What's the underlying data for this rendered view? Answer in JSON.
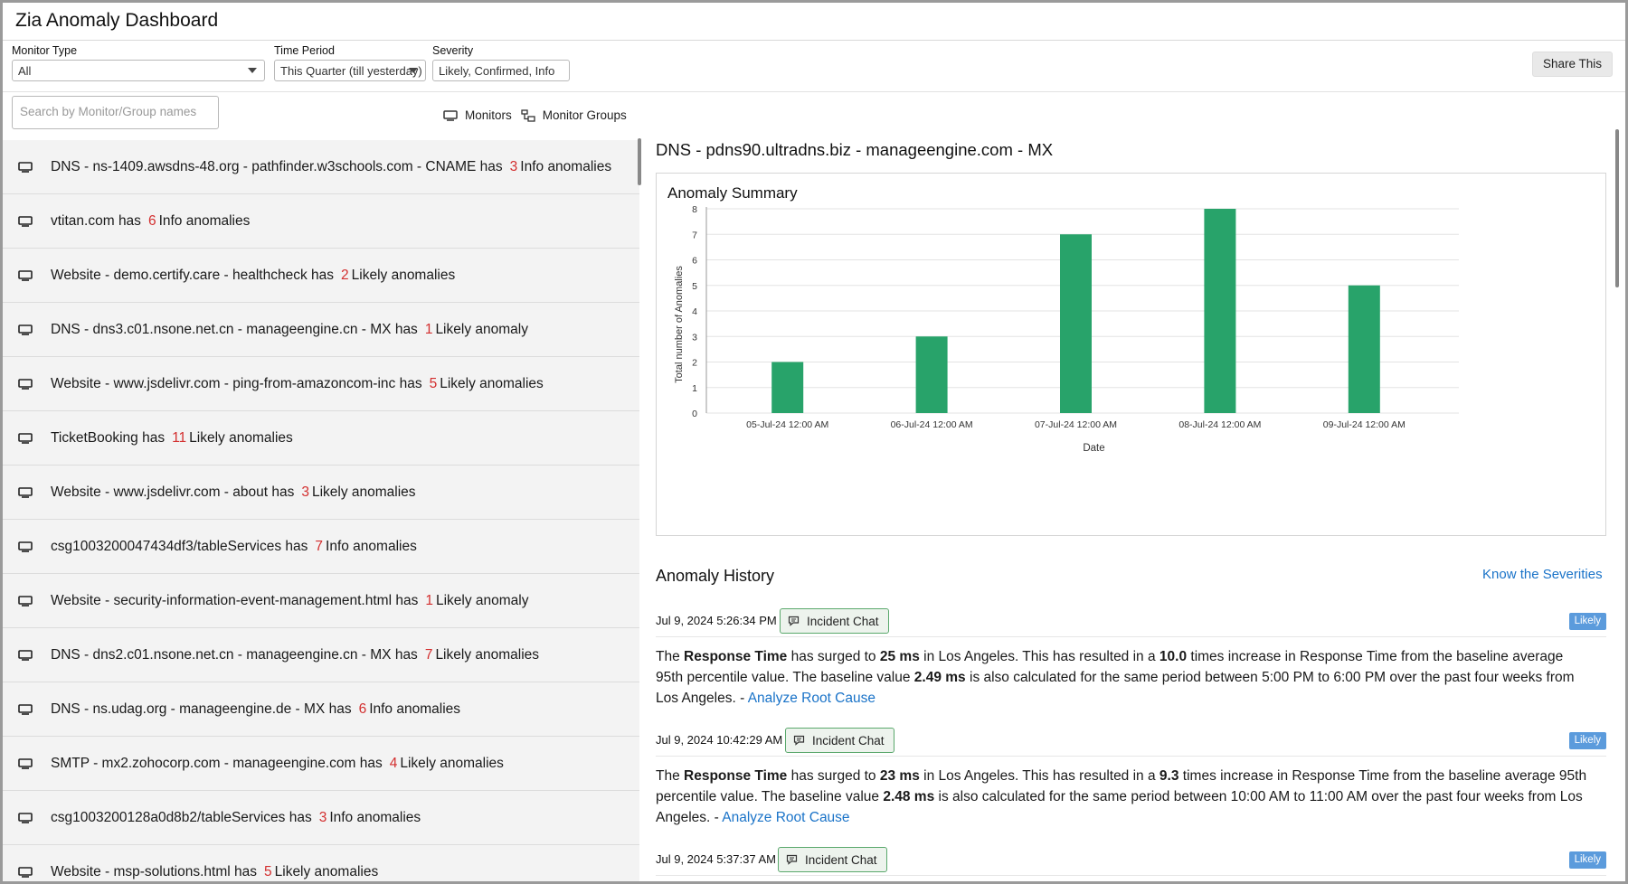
{
  "app": {
    "title": "Zia Anomaly Dashboard"
  },
  "filters": {
    "monitor_type": {
      "label": "Monitor Type",
      "value": "All"
    },
    "time_period": {
      "label": "Time Period",
      "value": "This Quarter (till yesterday)"
    },
    "severity": {
      "label": "Severity",
      "value": "Likely, Confirmed, Info"
    },
    "share_label": "Share This"
  },
  "search": {
    "placeholder": "Search by Monitor/Group names"
  },
  "toggles": {
    "monitors": "Monitors",
    "monitor_groups": "Monitor Groups"
  },
  "monitor_list": [
    {
      "name": "DNS - ns-1409.awsdns-48.org - pathfinder.w3schools.com - CNAME has",
      "count": "3",
      "suffix": "Info anomalies"
    },
    {
      "name": "vtitan.com has",
      "count": "6",
      "suffix": "Info anomalies"
    },
    {
      "name": "Website - demo.certify.care - healthcheck has",
      "count": "2",
      "suffix": "Likely anomalies"
    },
    {
      "name": "DNS - dns3.c01.nsone.net.cn - manageengine.cn - MX has",
      "count": "1",
      "suffix": "Likely anomaly"
    },
    {
      "name": "Website - www.jsdelivr.com - ping-from-amazoncom-inc has",
      "count": "5",
      "suffix": "Likely anomalies"
    },
    {
      "name": "TicketBooking has",
      "count": "11",
      "suffix": "Likely anomalies"
    },
    {
      "name": "Website - www.jsdelivr.com - about has",
      "count": "3",
      "suffix": "Likely anomalies"
    },
    {
      "name": "csg1003200047434df3/tableServices has",
      "count": "7",
      "suffix": "Info anomalies"
    },
    {
      "name": "Website - security-information-event-management.html has",
      "count": "1",
      "suffix": "Likely anomaly"
    },
    {
      "name": "DNS - dns2.c01.nsone.net.cn - manageengine.cn - MX has",
      "count": "7",
      "suffix": "Likely anomalies"
    },
    {
      "name": "DNS - ns.udag.org - manageengine.de - MX has",
      "count": "6",
      "suffix": "Info anomalies"
    },
    {
      "name": "SMTP - mx2.zohocorp.com - manageengine.com has",
      "count": "4",
      "suffix": "Likely anomalies"
    },
    {
      "name": "csg1003200128a0d8b2/tableServices has",
      "count": "3",
      "suffix": "Info anomalies"
    },
    {
      "name": "Website - msp-solutions.html has",
      "count": "5",
      "suffix": "Likely anomalies"
    }
  ],
  "detail": {
    "title": "DNS - pdns90.ultradns.biz - manageengine.com - MX",
    "summary_title": "Anomaly Summary",
    "history_title": "Anomaly History",
    "know_link": "Know the Severities"
  },
  "chart_data": {
    "type": "bar",
    "title": "",
    "xlabel": "Date",
    "ylabel": "Total number of Anomalies",
    "categories": [
      "05-Jul-24 12:00 AM",
      "06-Jul-24 12:00 AM",
      "07-Jul-24 12:00 AM",
      "08-Jul-24 12:00 AM",
      "09-Jul-24 12:00 AM"
    ],
    "values": [
      2,
      3,
      7,
      8,
      5
    ],
    "ylim": [
      0,
      8
    ],
    "yticks": [
      0,
      1,
      2,
      3,
      4,
      5,
      6,
      7,
      8
    ],
    "grid": true,
    "bar_color": "#28a36a"
  },
  "history": [
    {
      "time": "Jul 9, 2024 5:26:34 PM",
      "chat_label": "Incident Chat",
      "severity": "Likely",
      "p1": "The ",
      "metric": "Response Time",
      "p2": " has surged to ",
      "value": "25 ms",
      "p3": " in Los Angeles. This has resulted in a ",
      "factor": "10.0",
      "p4": " times increase in Response Time from the baseline average 95th percentile value. The baseline value ",
      "baseline": "2.49 ms",
      "p5": " is also calculated for the same period between 5:00 PM to 6:00 PM over the past four weeks from Los Angeles. - ",
      "link": "Analyze Root Cause"
    },
    {
      "time": "Jul 9, 2024 10:42:29 AM",
      "chat_label": "Incident Chat",
      "severity": "Likely",
      "p1": "The ",
      "metric": "Response Time",
      "p2": " has surged to ",
      "value": "23 ms",
      "p3": " in Los Angeles. This has resulted in a ",
      "factor": "9.3",
      "p4": " times increase in Response Time from the baseline average 95th percentile value. The baseline value ",
      "baseline": "2.48 ms",
      "p5": " is also calculated for the same period between 10:00 AM to 11:00 AM over the past four weeks from Los Angeles. - ",
      "link": "Analyze Root Cause"
    },
    {
      "time": "Jul 9, 2024 5:37:37 AM",
      "chat_label": "Incident Chat",
      "severity": "Likely"
    }
  ]
}
